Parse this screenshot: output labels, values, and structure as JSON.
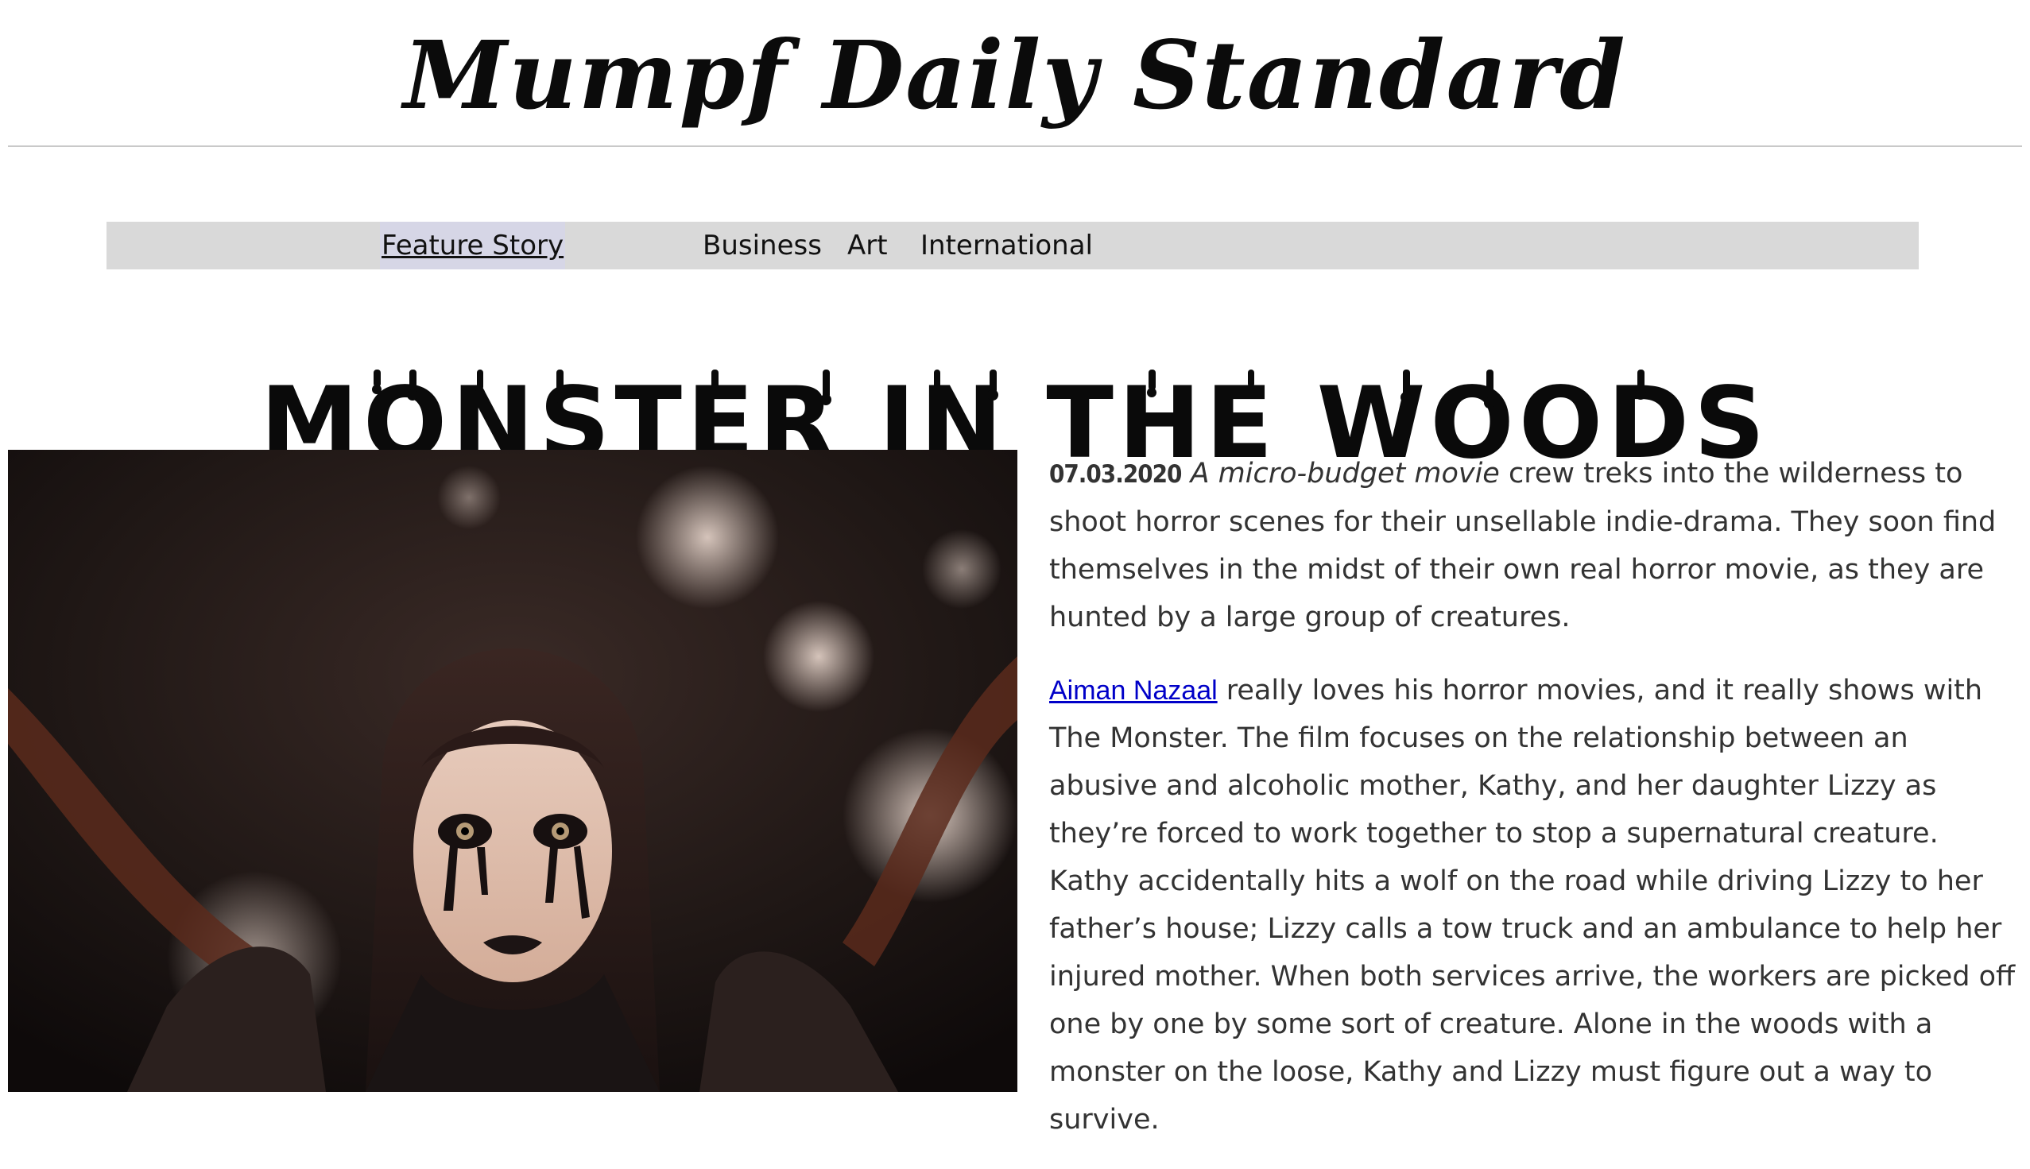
{
  "masthead": {
    "title": "Mumpf Daily Standard"
  },
  "nav": {
    "items": [
      {
        "label": "Feature Story",
        "active": true
      },
      {
        "label": "Business",
        "active": false
      },
      {
        "label": "Art",
        "active": false
      },
      {
        "label": "International",
        "active": false
      }
    ]
  },
  "article": {
    "headline": "MONSTER IN THE WOODS",
    "date": "07.03.2020",
    "lede_italic": "A micro-budget movie",
    "lede_rest": " crew treks into the wilderness to shoot horror scenes for their unsellable indie-drama. They soon find themselves in the midst of their own real horror movie, as they are hunted by a large group of creatures.",
    "author_link": "Aiman Nazaal",
    "body_rest": " really loves his horror movies, and it really shows with The Monster. The film focuses on the relationship between an abusive and alcoholic mother, Kathy, and her daughter Lizzy as they’re forced to work together to stop a supernatural creature. Kathy accidentally hits a wolf on the road while driving Lizzy to her father’s house; Lizzy calls a tow truck and an ambulance to help her injured mother. When both services arrive, the workers are picked off one by one by some sort of creature. Alone in the woods with a monster on the loose, Kathy and Lizzy must figure out a way to survive."
  },
  "colors": {
    "nav_background": "#d9d9d9",
    "nav_active_background": "#d6d6e6",
    "link": "#0000c8",
    "body_text": "#333333"
  }
}
